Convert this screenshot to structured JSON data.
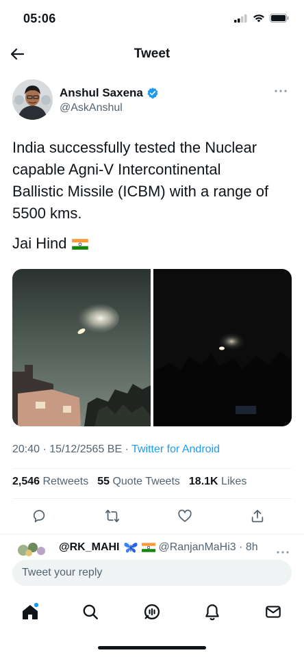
{
  "status_bar": {
    "time": "05:06"
  },
  "header": {
    "title": "Tweet"
  },
  "author": {
    "name": "Anshul Saxena",
    "handle": "@AskAnshul"
  },
  "tweet": {
    "lines": [
      "India successfully tested the Nuclear",
      "capable Agni-V Intercontinental",
      "Ballistic Missile (ICBM) with a range of",
      "5500 kms."
    ],
    "second_paragraph": "Jai Hind"
  },
  "meta": {
    "timestamp": "20:40 · 15/12/2565 BE · ",
    "source": "Twitter for Android"
  },
  "stats": {
    "retweets_count": "2,546",
    "retweets_label": "Retweets",
    "quotes_count": "55",
    "quotes_label": "Quote Tweets",
    "likes_count": "18.1K",
    "likes_label": "Likes"
  },
  "reply": {
    "name": "@RK_MAHI",
    "handle": "@RanjanMaHi3 · 8h"
  },
  "composer": {
    "placeholder": "Tweet your reply"
  },
  "icons": {
    "back": "arrow-left-icon",
    "verified": "verified-badge-icon",
    "more": "more-horizontal-icon",
    "reply": "reply-icon",
    "retweet": "retweet-icon",
    "like": "heart-icon",
    "share": "share-icon",
    "home": "home-icon",
    "search": "search-icon",
    "spaces": "spaces-icon",
    "notifications": "bell-icon",
    "messages": "mail-icon"
  },
  "colors": {
    "accent": "#1d9bf0",
    "text": "#0f1419",
    "secondary": "#536471"
  }
}
